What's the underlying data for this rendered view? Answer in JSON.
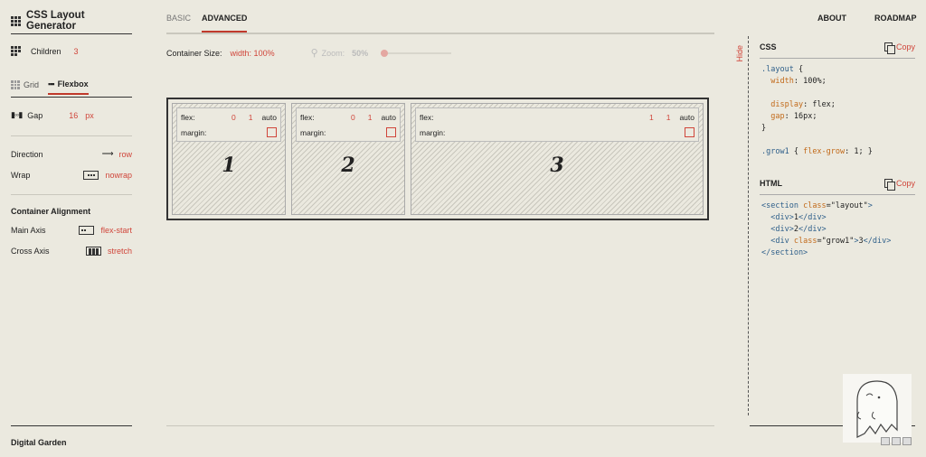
{
  "app": {
    "title": "CSS Layout Generator",
    "footer": "Digital Garden"
  },
  "sidebar": {
    "children_label": "Children",
    "children_value": "3",
    "tabs": [
      {
        "label": "Grid"
      },
      {
        "label": "Flexbox"
      }
    ],
    "gap_label": "Gap",
    "gap_value": "16",
    "gap_unit": "px",
    "direction_label": "Direction",
    "direction_value": "row",
    "wrap_label": "Wrap",
    "wrap_value": "nowrap",
    "container_alignment_heading": "Container Alignment",
    "main_axis_label": "Main Axis",
    "main_axis_value": "flex-start",
    "cross_axis_label": "Cross Axis",
    "cross_axis_value": "stretch"
  },
  "topnav": {
    "basic": "BASIC",
    "advanced": "ADVANCED",
    "about": "ABOUT",
    "roadmap": "ROADMAP"
  },
  "toolbar": {
    "container_size_label": "Container Size:",
    "container_size_value": "width: 100%",
    "zoom_label": "Zoom:",
    "zoom_value": "50%",
    "zoom_level": 0.0
  },
  "preview": {
    "items": [
      {
        "flex_label": "flex:",
        "grow": "0",
        "shrink": "1",
        "basis": "auto",
        "margin_label": "margin:",
        "number": "1"
      },
      {
        "flex_label": "flex:",
        "grow": "0",
        "shrink": "1",
        "basis": "auto",
        "margin_label": "margin:",
        "number": "2"
      },
      {
        "flex_label": "flex:",
        "grow": "1",
        "shrink": "1",
        "basis": "auto",
        "margin_label": "margin:",
        "number": "3"
      }
    ]
  },
  "right_panel": {
    "hide_label": "Hide",
    "css_heading": "CSS",
    "html_heading": "HTML",
    "copy_label": "Copy",
    "css": {
      "selector1": ".layout",
      "open": " {",
      "close": "}",
      "width_prop": "width",
      "width_val": "100%;",
      "display_prop": "display",
      "display_val": "flex;",
      "gap_prop": "gap",
      "gap_val": "16px;",
      "selector2": ".grow1",
      "grow_rule_open": " { ",
      "grow_prop": "flex-grow",
      "grow_val": "1;",
      "grow_rule_close": " }"
    },
    "html": {
      "section_open_tag": "<section",
      "class_attr": "class",
      "section_class": "\"layout\"",
      "tag_close": ">",
      "div_open": "<div>",
      "div_close": "</div>",
      "div1_text": "1",
      "div2_text": "2",
      "div3_open": "<div",
      "div3_class": "\"grow1\"",
      "div3_text": "3",
      "section_close": "</section>"
    }
  }
}
